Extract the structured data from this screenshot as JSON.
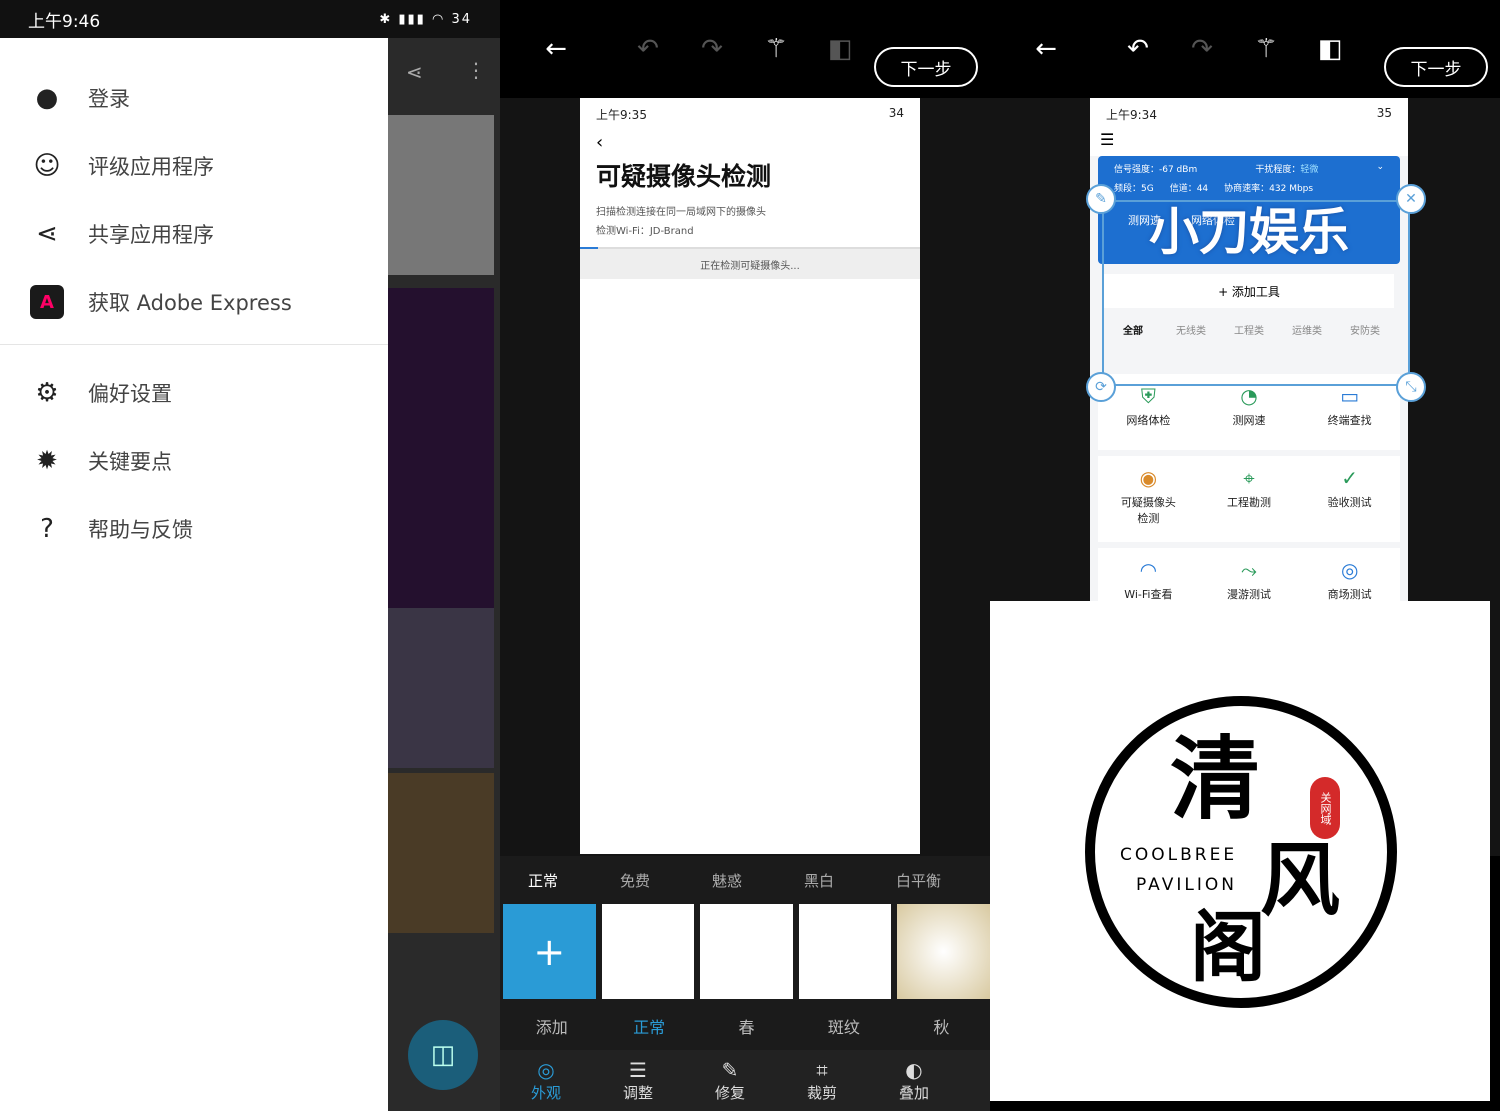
{
  "status1": {
    "time": "上午9:46",
    "battery": "34"
  },
  "drawer": {
    "items": [
      {
        "label": "登录",
        "icon": "account-icon"
      },
      {
        "label": "评级应用程序",
        "icon": "smile-icon"
      },
      {
        "label": "共享应用程序",
        "icon": "share-icon"
      },
      {
        "label": "获取 Adobe Express",
        "icon": "adobe-express-icon"
      }
    ],
    "items2": [
      {
        "label": "偏好设置",
        "icon": "gear-icon"
      },
      {
        "label": "关键要点",
        "icon": "alert-badge-icon"
      },
      {
        "label": "帮助与反馈",
        "icon": "help-icon"
      }
    ]
  },
  "editor": {
    "next_label": "下一步"
  },
  "shot1": {
    "time": "上午9:35",
    "battery": "34",
    "title": "可疑摄像头检测",
    "desc": "扫描检测连接在同一局域网下的摄像头",
    "wifi": "检测Wi-Fi：JD-Brand",
    "scanning": "正在检测可疑摄像头..."
  },
  "filters": {
    "tabs": [
      "正常",
      "免费",
      "魅惑",
      "黑白",
      "白平衡"
    ],
    "thumbs": [
      "添加",
      "正常",
      "春",
      "斑纹",
      "秋"
    ]
  },
  "bottom_nav": [
    "外观",
    "调整",
    "修复",
    "裁剪",
    "叠加"
  ],
  "shot2": {
    "time": "上午9:34",
    "battery": "35",
    "signal": "信号强度：-67 dBm",
    "interference_label": "干扰程度：",
    "interference": "轻微",
    "band": "频段：5G",
    "channel": "信道：44",
    "rate": "协商速率：432 Mbps",
    "watermark": "小刀娱乐",
    "speed": "测网速",
    "check": "网络体检",
    "tools": "+ 添加工具",
    "tabs": [
      "全部",
      "无线类",
      "工程类",
      "运维类",
      "安防类"
    ],
    "row1": [
      "网络体检",
      "测网速",
      "终端查找"
    ],
    "row2": [
      "可疑摄像头检测",
      "工程勘测",
      "验收测试"
    ],
    "row3": [
      "Wi-Fi查看",
      "漫游测试",
      "商场测试"
    ]
  },
  "logo": {
    "big1": "清",
    "big2": "风",
    "big3": "阁",
    "en1": "COOLBREE",
    "en2": "PAVILION",
    "seal": "关网域"
  }
}
